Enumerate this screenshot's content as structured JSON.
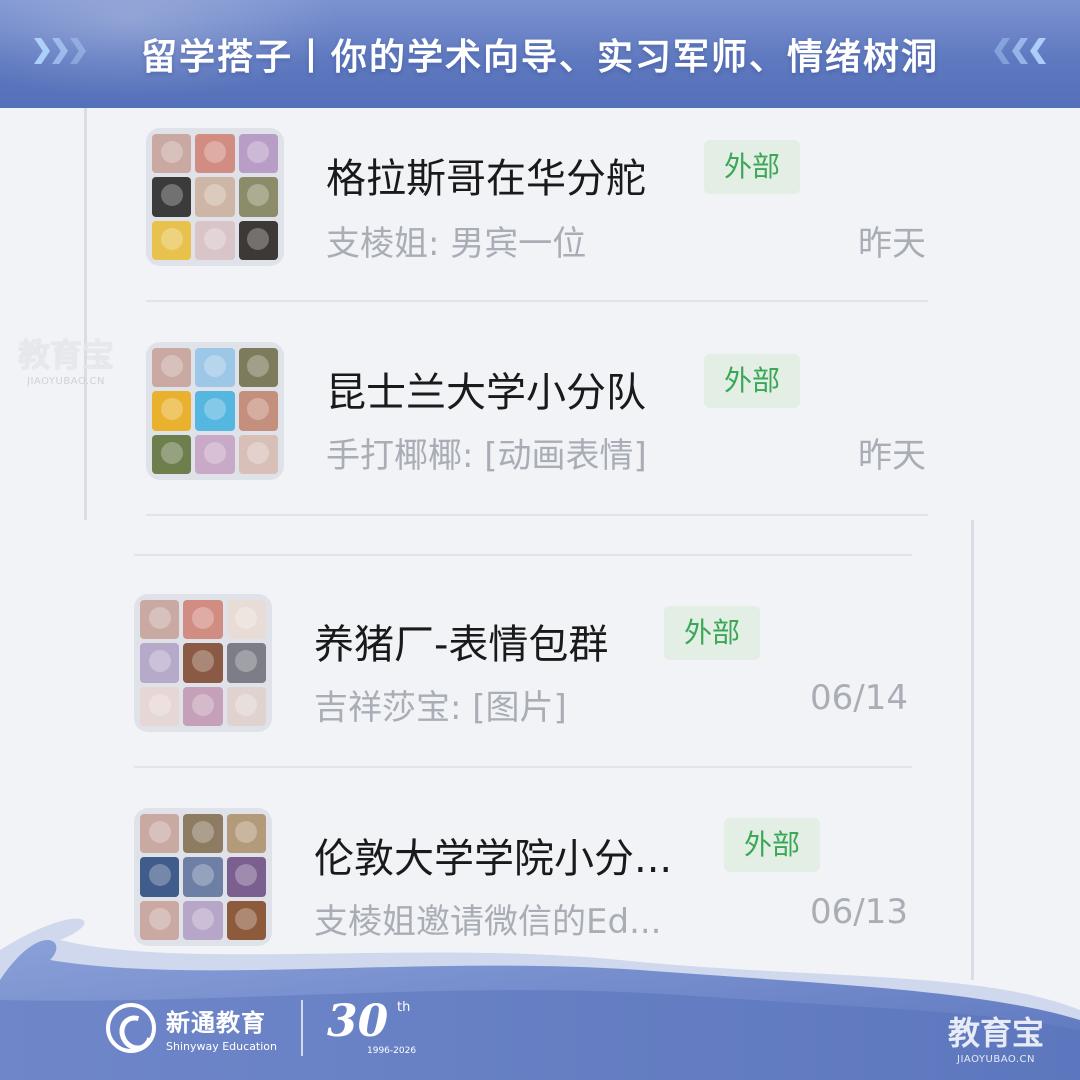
{
  "header": {
    "title": "留学搭子丨你的学术向导、实习军师、情绪树洞"
  },
  "chats": [
    {
      "name": "格拉斯哥在华分舵",
      "tag": "外部",
      "preview": "支棱姐: 男宾一位",
      "time": "昨天",
      "avatar_colors": [
        "#c9a9a2",
        "#d28d83",
        "#b89ec6",
        "#3b3b3b",
        "#cdb6a5",
        "#8c8c6a",
        "#e8c24d",
        "#d9c4c8",
        "#3d3a36"
      ]
    },
    {
      "name": "昆士兰大学小分队",
      "tag": "外部",
      "preview": "手打椰椰: [动画表情]",
      "time": "昨天",
      "avatar_colors": [
        "#c9a9a2",
        "#9cc7e6",
        "#7d7b5c",
        "#e9b12e",
        "#55b6e0",
        "#c58f7d",
        "#6e7f4e",
        "#c9a9c8",
        "#d8c0b8"
      ]
    },
    {
      "name": "养猪厂-表情包群",
      "tag": "外部",
      "preview": "吉祥莎宝: [图片]",
      "time": "06/14",
      "avatar_colors": [
        "#c9a9a2",
        "#d28d83",
        "#e8dcd6",
        "#b7a9c9",
        "#8a5a44",
        "#7c7d86",
        "#e6d6d4",
        "#c5a0b8",
        "#e0d2cf"
      ]
    },
    {
      "name": "伦敦大学学院小分...",
      "tag": "外部",
      "preview": "支棱姐邀请微信的Ed...",
      "time": "06/13",
      "avatar_colors": [
        "#c9a9a2",
        "#8d7b62",
        "#b39a7a",
        "#3f5c8a",
        "#6d7fa5",
        "#7b5f8f",
        "#c9a9a2",
        "#b8a6c8",
        "#8e5a3c"
      ]
    }
  ],
  "footer": {
    "brand_cn": "新通教育",
    "brand_en": "Shinyway Education",
    "anniversary_number": "30",
    "anniversary_suffix": "th",
    "anniversary_years": "1996-2026"
  },
  "watermarks": [
    {
      "text": "教育宝",
      "domain": "JIAOYUBAO.CN"
    },
    {
      "text": "教育宝",
      "domain": "JIAOYUBAO.CN"
    }
  ],
  "colors": {
    "header_blue": "#5f79c0",
    "tag_green": "#3aa856",
    "tag_bg": "#e3eee5",
    "muted_text": "#a9aeb6",
    "background": "#f1f3f6"
  }
}
